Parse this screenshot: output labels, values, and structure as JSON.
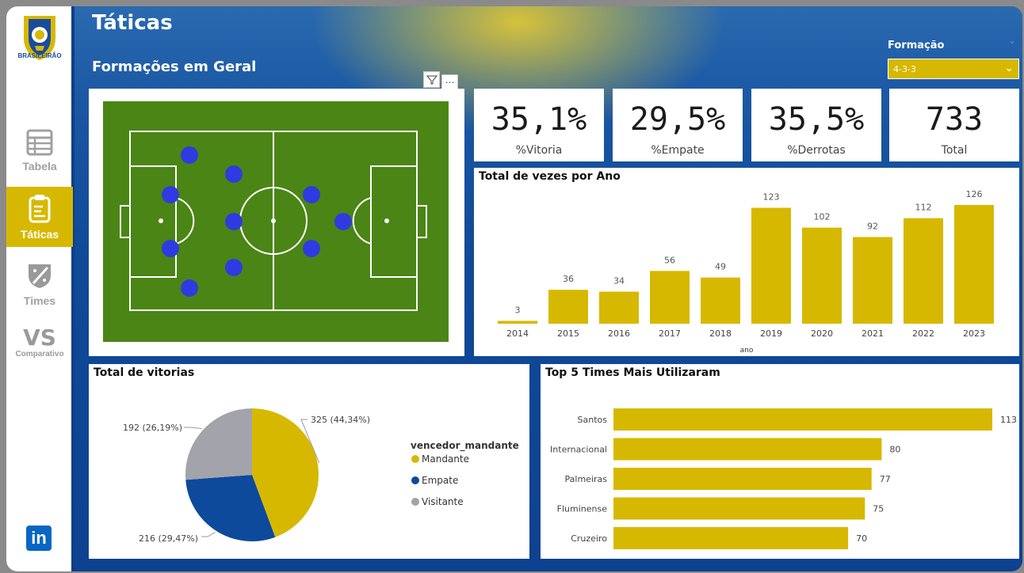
{
  "sidebar": {
    "logo_text": "BRASILEIRÃO",
    "items": [
      {
        "label": "Tabela",
        "icon": "table-icon"
      },
      {
        "label": "Táticas",
        "icon": "clipboard-icon"
      },
      {
        "label": "Times",
        "icon": "shield-icon"
      },
      {
        "label": "VS",
        "sub": "Comparativo",
        "icon": "vs-icon"
      }
    ],
    "linkedin": "in"
  },
  "header": {
    "title": "Táticas",
    "section": "Formações em Geral"
  },
  "slicer": {
    "label": "Formação",
    "value": "4-3-3"
  },
  "kpis": [
    {
      "value": "35,1%",
      "label": "%Vitoria"
    },
    {
      "value": "29,5%",
      "label": "%Empate"
    },
    {
      "value": "35,5%",
      "label": "%Derrotas"
    },
    {
      "value": "733",
      "label": "Total"
    }
  ],
  "colors": {
    "accent": "#d7b800",
    "brand_blue": "#0d3f86",
    "pitch": "#4a8516",
    "player": "#2f3be0",
    "empate": "#0d4a9c",
    "visitante": "#a2a3ab"
  },
  "chart_data": [
    {
      "type": "bar",
      "title": "Total de vezes por Ano",
      "xlabel": "ano",
      "categories": [
        "2014",
        "2015",
        "2016",
        "2017",
        "2018",
        "2019",
        "2020",
        "2021",
        "2022",
        "2023"
      ],
      "values": [
        3,
        36,
        34,
        56,
        49,
        123,
        102,
        92,
        112,
        126
      ]
    },
    {
      "type": "pie",
      "title": "Total de vitorias",
      "legend_title": "vencedor_mandante",
      "slices": [
        {
          "name": "Mandante",
          "value": 325,
          "label": "325 (44,34%)"
        },
        {
          "name": "Empate",
          "value": 216,
          "label": "216 (29,47%)"
        },
        {
          "name": "Visitante",
          "value": 192,
          "label": "192 (26,19%)"
        }
      ]
    },
    {
      "type": "bar",
      "orientation": "horizontal",
      "title": "Top 5 Times Mais Utilizaram",
      "categories": [
        "Santos",
        "Internacional",
        "Palmeiras",
        "Fluminense",
        "Cruzeiro"
      ],
      "values": [
        113,
        80,
        77,
        75,
        70
      ]
    }
  ]
}
